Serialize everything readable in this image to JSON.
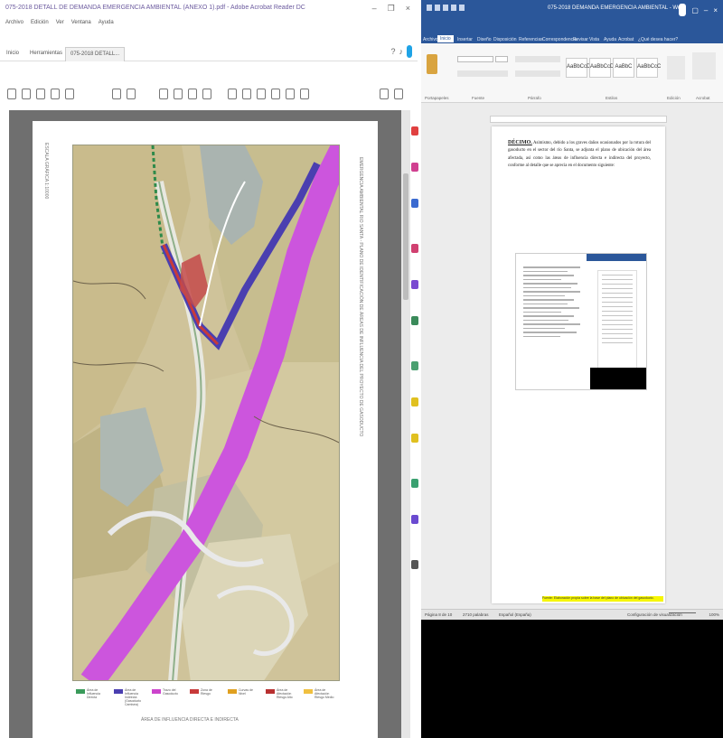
{
  "pdf_viewer": {
    "title": "075-2018 DETALL DE DEMANDA EMERGENCIA AMBIENTAL (ANEXO 1).pdf - Adobe Acrobat Reader DC",
    "menu": [
      "Archivo",
      "Edición",
      "Ver",
      "Ventana",
      "Ayuda"
    ],
    "tabs": [
      "Inicio",
      "Herramientas",
      "075-2018 DETALL..."
    ],
    "window_controls": [
      "–",
      "❐",
      "×"
    ],
    "page_side_text": "EMERGENCIA AMBIENTAL RIO SANTA - PLANO DE IDENTIFICACIÓN DE ÁREAS DE INFLUENCIA DEL PROYECTO DE GASODUCTO",
    "page_bottom_text": "ÁREA DE INFLUENCIA DIRECTA E INDIRECTA",
    "left_margin_text": "ESCALA GRÁFICA 1:10000",
    "legend": [
      {
        "label": "Área de Influencia Directa",
        "color": "#3a9a5a"
      },
      {
        "label": "Área de Influencia Indirecta (Gasoducto Camisea)",
        "color": "#4a3fb0"
      },
      {
        "label": "Trazo del Gasoducto",
        "color": "#cc44cc"
      },
      {
        "label": "Zona de Riesgo",
        "color": "#c83a3a"
      },
      {
        "label": "Curvas de Nivel",
        "color": "#e0a020"
      },
      {
        "label": "Área de Afectación Riesgo Alto",
        "color": "#b83030"
      },
      {
        "label": "Área de Afectación Riesgo Medio",
        "color": "#f0c040"
      }
    ]
  },
  "word": {
    "title": "075-2018 DEMANDA EMERGENCIA AMBIENTAL - Word",
    "ribbon_tabs": [
      "Archivo",
      "Inicio",
      "Insertar",
      "Diseño",
      "Disposición",
      "Referencias",
      "Correspondencia",
      "Revisar",
      "Vista",
      "Ayuda",
      "Acrobat",
      "¿Qué desea hacer?"
    ],
    "active_tab": "Inicio",
    "ribbon_groups": [
      "Portapapeles",
      "Fuente",
      "Párrafo",
      "Estilos",
      "Edición",
      "Acrobat"
    ],
    "styles": [
      "AaBbCcDc",
      "AaBbCcDc",
      "AaBbC",
      "AaBbCcC"
    ],
    "doc_heading": "DÉCIMO.",
    "doc_text": "Asimismo, debido a los graves daños ocasionados por la rotura del gasoducto en el sector del río Santa, se adjunta el plano de ubicación del área afectada, así como las áreas de influencia directa e indirecta del proyecto, conforme al detalle que se aprecia en el documento siguiente:",
    "highlight_text": "Fuente: Elaboración propia sobre la base del plano de ubicación del gasoducto.",
    "status": {
      "page": "Página 8 de 10",
      "words": "2710 palabras",
      "language": "Español (España)",
      "view": "Configuración de visualización",
      "zoom": "100%"
    }
  }
}
